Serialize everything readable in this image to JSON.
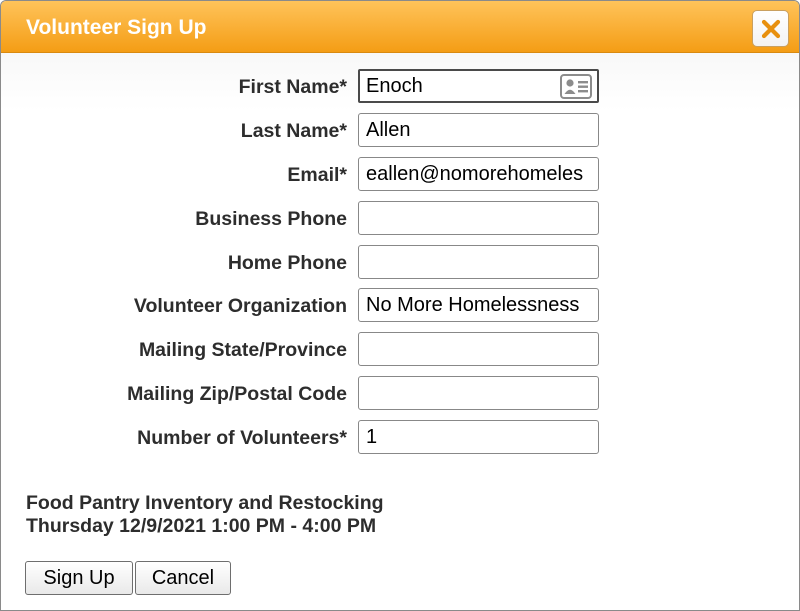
{
  "dialog": {
    "title": "Volunteer Sign Up",
    "close_icon": "close-icon",
    "accent_color": "#f49d15",
    "close_icon_color": "#e8900e"
  },
  "form": {
    "fields": [
      {
        "label": "First Name*",
        "value": "Enoch",
        "placeholder": ""
      },
      {
        "label": "Last Name*",
        "value": "Allen",
        "placeholder": ""
      },
      {
        "label": "Email*",
        "value": "eallen@nomorehomeles",
        "placeholder": ""
      },
      {
        "label": "Business Phone",
        "value": "",
        "placeholder": ""
      },
      {
        "label": "Home Phone",
        "value": "",
        "placeholder": ""
      },
      {
        "label": "Volunteer Organization",
        "value": "No More Homelessness",
        "placeholder": ""
      },
      {
        "label": "Mailing State/Province",
        "value": "",
        "placeholder": ""
      },
      {
        "label": "Mailing Zip/Postal Code",
        "value": "",
        "placeholder": ""
      },
      {
        "label": "Number of Volunteers*",
        "value": "1",
        "placeholder": ""
      }
    ],
    "contact_card_icon": "contact-card-icon"
  },
  "event": {
    "name": "Food Pantry Inventory and Restocking",
    "datetime": "Thursday 12/9/2021 1:00 PM - 4:00 PM"
  },
  "actions": {
    "signup_label": "Sign Up",
    "cancel_label": "Cancel"
  }
}
